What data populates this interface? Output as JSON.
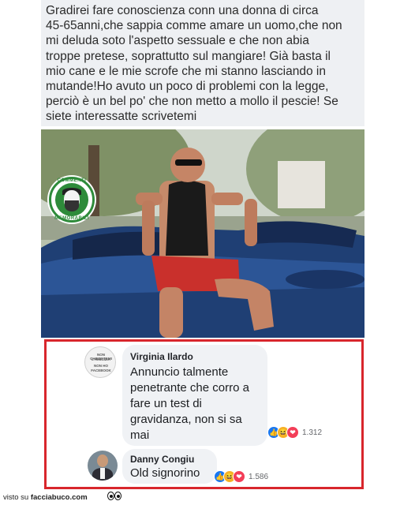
{
  "post": {
    "text": "Gradirei fare conoscienza conn una donna di circa\n45-65anni,che sappia comme amare un uomo,che non\nmi deluda soto l'aspetto sessuale e che non abia\ntroppe pretese, soprattutto sul mangiare! Già basta il\nmio cane e le mie scrofe che mi stanno lasciando in\nmutande!Ho avuto un poco di problemi con la legge,\nperciò è un bel po' che non metto a mollo il pescie! Se\nsiete interessatte scrivetemi"
  },
  "badge": {
    "top_text": "COMMENTI",
    "bottom_text": "MEMORABILI"
  },
  "comments": [
    {
      "author": "Virginia Ilardo",
      "avatar_lines": [
        "NON CHIEDETEMI",
        "L'AMICIZIA",
        "NON HO",
        "FACEBOOK"
      ],
      "text": "Annuncio talmente\npenetrante che corro a\nfare un test di\ngravidanza, non si sa\nmai",
      "reactions": [
        "like",
        "haha",
        "love"
      ],
      "reaction_count": "1.312"
    },
    {
      "author": "Danny Congiu",
      "text": "Old signorino",
      "reactions": [
        "like",
        "haha",
        "love"
      ],
      "reaction_count": "1.586"
    }
  ],
  "footer": {
    "prefix": "visto su",
    "site": "facciabuco.com"
  },
  "colors": {
    "highlight_border": "#d8262c",
    "badge_green": "#2e8b3a",
    "like_blue": "#1877f2",
    "love_red": "#f33e58",
    "haha_yellow": "#f7b125"
  }
}
